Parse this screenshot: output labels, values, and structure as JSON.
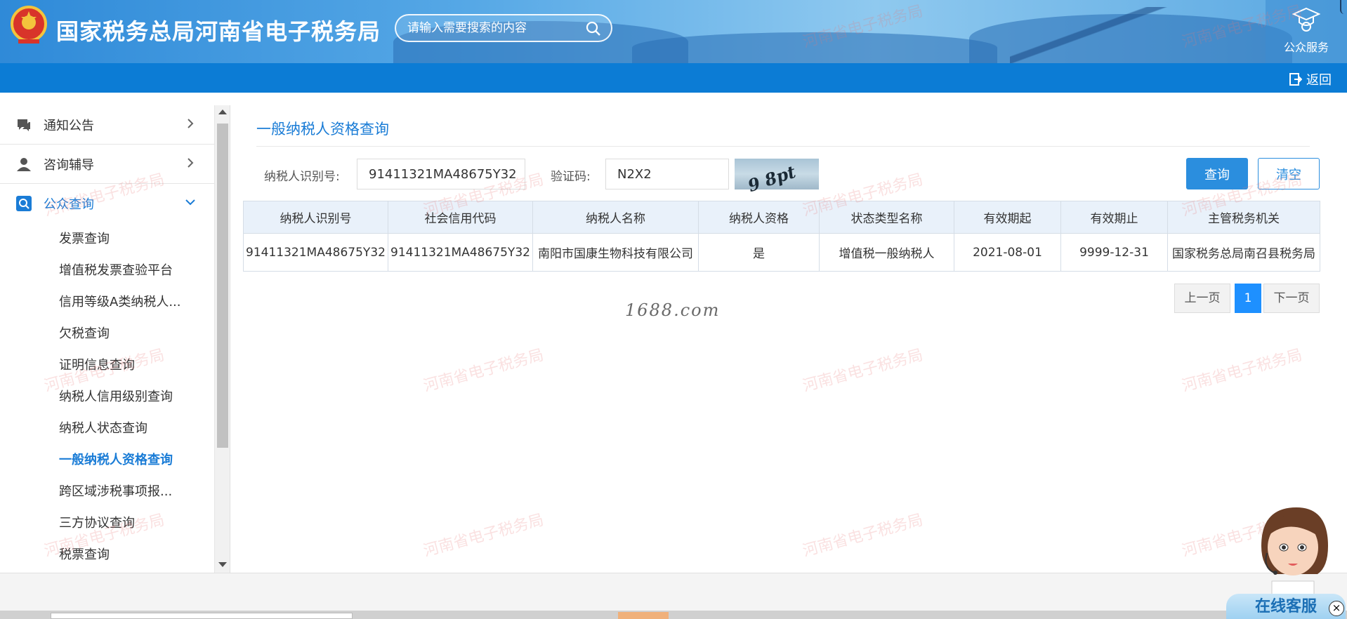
{
  "header": {
    "site_title": "国家税务总局河南省电子税务局",
    "search_placeholder": "请输入需要搜索的内容",
    "public_service_label": "公众服务",
    "back_label": "返回"
  },
  "sidebar": {
    "main_items": [
      {
        "label": "通知公告",
        "icon": "megaphone-icon"
      },
      {
        "label": "咨询辅导",
        "icon": "person-icon"
      },
      {
        "label": "公众查询",
        "icon": "search-icon"
      }
    ],
    "sub_items": [
      {
        "label": "发票查询"
      },
      {
        "label": "增值税发票查验平台"
      },
      {
        "label": "信用等级A类纳税人..."
      },
      {
        "label": "欠税查询"
      },
      {
        "label": "证明信息查询"
      },
      {
        "label": "纳税人信用级别查询"
      },
      {
        "label": "纳税人状态查询"
      },
      {
        "label": "一般纳税人资格查询"
      },
      {
        "label": "跨区域涉税事项报..."
      },
      {
        "label": "三方协议查询"
      },
      {
        "label": "税票查询"
      }
    ]
  },
  "main": {
    "page_title": "一般纳税人资格查询",
    "form": {
      "taxpayer_id_label": "纳税人识别号:",
      "taxpayer_id_value": "91411321MA48675Y32",
      "captcha_label": "验证码:",
      "captcha_value": "N2X2",
      "captcha_image_text": "9 8pt",
      "query_button": "查询",
      "clear_button": "清空"
    },
    "table": {
      "headers": [
        "纳税人识别号",
        "社会信用代码",
        "纳税人名称",
        "纳税人资格",
        "状态类型名称",
        "有效期起",
        "有效期止",
        "主管税务机关"
      ],
      "rows": [
        [
          "91411321MA48675Y32",
          "91411321MA48675Y32",
          "南阳市国康生物科技有限公司",
          "是",
          "增值税一般纳税人",
          "2021-08-01",
          "9999-12-31",
          "国家税务总局南召县税务局"
        ]
      ]
    },
    "pagination": {
      "prev": "上一页",
      "current": "1",
      "next": "下一页"
    },
    "site_mark": "1688.com"
  },
  "watermark_text": "河南省电子税务局",
  "customer_service": {
    "label": "在线客服",
    "close": "×"
  },
  "colors": {
    "header_blue": "#2f8ad8",
    "subbar_blue": "#0c7cd5",
    "accent": "#1a7cd6",
    "button_blue": "#2b8ede"
  }
}
